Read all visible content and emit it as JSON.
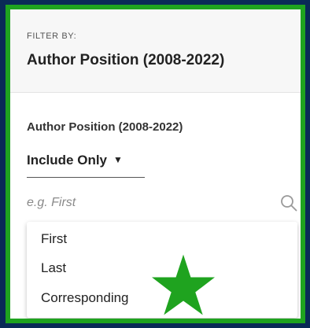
{
  "header": {
    "filter_by_label": "FILTER BY:",
    "title": "Author Position (2008-2022)"
  },
  "filter": {
    "section_label": "Author Position (2008-2022)",
    "mode_value": "Include Only",
    "mode_caret": "▼",
    "search_placeholder": "e.g. First",
    "options": [
      "First",
      "Last",
      "Corresponding"
    ]
  },
  "annotation": {
    "icon": "star-icon",
    "color": "#1fa31f"
  },
  "colors": {
    "frame": "#1fa31f",
    "outer_background": "#0a2a57"
  }
}
